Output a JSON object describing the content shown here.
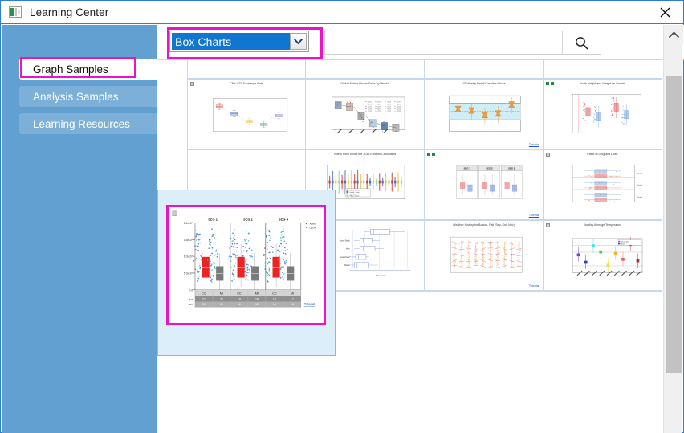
{
  "window": {
    "title": "Learning Center",
    "app_icon": "app-window-icon",
    "close_label": "✕"
  },
  "sidebar": {
    "items": [
      {
        "label": "Graph Samples",
        "state": "active"
      },
      {
        "label": "Analysis Samples",
        "state": "normal"
      },
      {
        "label": "Learning Resources",
        "state": "normal"
      }
    ]
  },
  "toolbar": {
    "category": {
      "selected": "Box Charts",
      "arrow_icon": "chevron-down-icon"
    },
    "search": {
      "value": "",
      "placeholder": "",
      "button_icon": "search-icon"
    }
  },
  "annotations": {
    "accent_color": "#ec13c4",
    "highlight_color": "#ddeefb"
  },
  "colors": {
    "sidebar_bg": "#63a0d2",
    "select_blue": "#1076d0",
    "grid_border": "#c6d7ef",
    "title_border": "#2c7fd0"
  },
  "scrollbar": {
    "up_icon": "chevron-up-icon",
    "thumb": "scroll-thumb"
  },
  "gallery": {
    "tutorial_label": "Tutorial",
    "thumbnails": [
      {
        "id": "r0c0",
        "title": "",
        "kind": "bar-scatter",
        "tutorial": false,
        "badge": "none"
      },
      {
        "id": "r0c1",
        "title": "",
        "kind": "multi-box",
        "tutorial": false,
        "badge": "none"
      },
      {
        "id": "r0c2",
        "title": "",
        "kind": "histogram",
        "tutorial": false,
        "badge": "none"
      },
      {
        "id": "r0c3",
        "title": "",
        "kind": "grey-box",
        "tutorial": false,
        "badge": "none"
      },
      {
        "id": "r1c0",
        "title": "CNY USD Exchange Rate",
        "kind": "connected-box",
        "tutorial": false,
        "badge": "sheet"
      },
      {
        "id": "r1c1",
        "title": "Global Mobile Phone Sales by Vendor",
        "kind": "trend-box",
        "tutorial": false,
        "badge": "none"
      },
      {
        "id": "r1c2",
        "title": "US Weekly Retail Gasoline Prices",
        "kind": "notched-box",
        "tutorial": true,
        "badge": "none"
      },
      {
        "id": "r1c3",
        "title": "Youth Height and Weight by Gender",
        "kind": "paired-box",
        "tutorial": false,
        "badge": "green"
      },
      {
        "id": "r2c0",
        "title": "",
        "kind": "selected-placeholder",
        "tutorial": false,
        "badge": "none"
      },
      {
        "id": "r2c1",
        "title": "Voters Form About the 2016 Election Candidates",
        "kind": "multi-color-box",
        "tutorial": false,
        "badge": "none"
      },
      {
        "id": "r2c2",
        "title": "",
        "kind": "panel-box",
        "tutorial": true,
        "badge": "green"
      },
      {
        "id": "r2c3",
        "title": "Effect of Drug and Dose",
        "kind": "horizontal-box",
        "tutorial": false,
        "badge": "sheet"
      },
      {
        "id": "r3c0",
        "title": "",
        "kind": "mean-sd-plot",
        "tutorial": false,
        "badge": "none"
      },
      {
        "id": "r3c1",
        "title": "",
        "kind": "horizontal-price-box",
        "tutorial": false,
        "badge": "none"
      },
      {
        "id": "r3c2",
        "title": "Weather History for Boston, Fall (Sep, Oct, Nov)",
        "kind": "weather-box",
        "tutorial": true,
        "badge": "none"
      },
      {
        "id": "r3c3",
        "title": "Monthly Average Temperature",
        "kind": "temp-scatter",
        "tutorial": false,
        "badge": "sheet"
      }
    ]
  },
  "selected_thumbnail": {
    "panel_titles": [
      "SEG 1",
      "SEG 2",
      "SEG 4"
    ],
    "y_ticks": [
      "2.0x10⁶",
      "1.5x10⁶",
      "1.0x10⁶",
      "5.0x10⁵",
      "0.0"
    ],
    "group_labels": [
      "CC",
      "MI",
      "CC",
      "MI",
      "CC",
      "MI"
    ],
    "row_labels": [
      "Nₐ",
      "Nₑ"
    ],
    "counts_row1": [
      "21",
      "20",
      "10",
      "18",
      "18",
      "17"
    ],
    "counts_row2": [
      "21",
      "20",
      "10",
      "18",
      "18",
      "16"
    ],
    "legend": [
      "A386",
      "CD34"
    ],
    "tutorial_label": "Tutorial",
    "box_colors": {
      "group_a": "#ee2222",
      "group_b": "#7a7a7a"
    },
    "point_colors": {
      "blue": "#4a5fd0",
      "teal": "#34b8c0"
    }
  },
  "chart_data": {
    "type": "box",
    "title": "",
    "panels": [
      "SEG 1",
      "SEG 2",
      "SEG 4"
    ],
    "categories": [
      "CC",
      "MI"
    ],
    "ylabel": "",
    "ylim": [
      0,
      2000000
    ],
    "yticks": [
      0,
      500000,
      1000000,
      1500000,
      2000000
    ],
    "series": [
      {
        "name": "CC",
        "color": "#ee2222",
        "values": [
          620000,
          650000,
          700000
        ]
      },
      {
        "name": "MI",
        "color": "#7a7a7a",
        "values": [
          420000,
          400000,
          430000
        ]
      }
    ],
    "n_counts": [
      [
        21,
        20
      ],
      [
        10,
        18
      ],
      [
        18,
        17
      ]
    ],
    "grid": false,
    "legend": [
      "A386",
      "CD34"
    ]
  }
}
